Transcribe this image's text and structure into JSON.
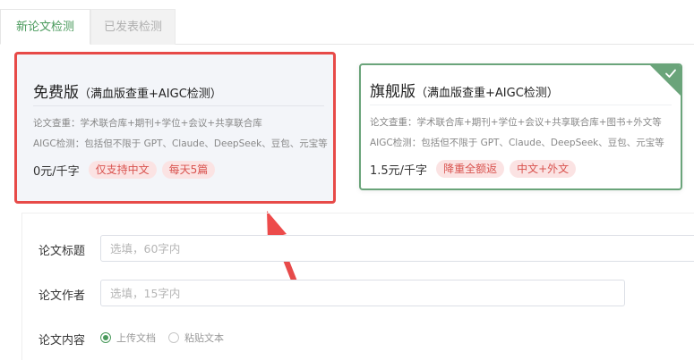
{
  "tabs": {
    "new_check": "新论文检测",
    "published_check": "已发表检测"
  },
  "plans": {
    "free": {
      "name": "免费版",
      "subtitle": "（满血版查重+AIGC检测）",
      "desc1": "论文查重：学术联合库+期刊+学位+会议+共享联合库",
      "desc2": "AIGC检测：包括但不限于 GPT、Claude、DeepSeek、豆包、元宝等",
      "price": "0元/千字",
      "tag1": "仅支持中文",
      "tag2": "每天5篇"
    },
    "pro": {
      "name": "旗舰版",
      "subtitle": "（满血版查重+AIGC检测）",
      "desc1": "论文查重：学术联合库+期刊+学位+会议+共享联合库+图书+外文等",
      "desc2": "AIGC检测：包括但不限于 GPT、Claude、DeepSeek、豆包、元宝等",
      "price": "1.5元/千字",
      "tag1": "降重全额返",
      "tag2": "中文+外文",
      "selected_icon": "check-icon"
    }
  },
  "form": {
    "title_label": "论文标题",
    "title_placeholder": "选填，60字内",
    "author_label": "论文作者",
    "author_placeholder": "选填，15字内",
    "content_label": "论文内容",
    "option_upload": "上传文档",
    "option_paste": "粘贴文本"
  },
  "colors": {
    "accent_green": "#4a9a5c",
    "highlight_red": "#e74a48",
    "tag_red": "#d9534f",
    "tag_bg": "#fbe3e3"
  }
}
